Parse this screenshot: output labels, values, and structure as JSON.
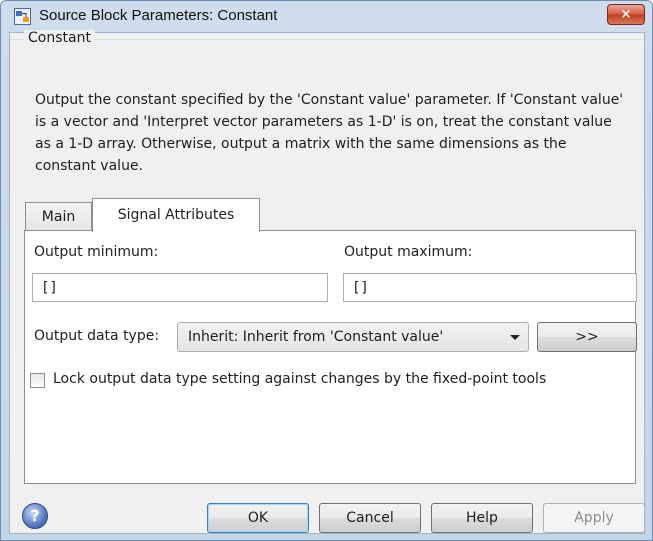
{
  "window": {
    "title": "Source Block Parameters: Constant",
    "close_glyph": "×"
  },
  "group": {
    "label": "Constant",
    "description": "Output the constant specified by the 'Constant value' parameter. If 'Constant value' is a vector and 'Interpret vector parameters as 1-D' is on, treat the constant value as a 1-D array. Otherwise, output a matrix with the same dimensions as the constant value."
  },
  "tabs": [
    {
      "label": "Main",
      "active": false
    },
    {
      "label": "Signal Attributes",
      "active": true
    }
  ],
  "signal_attributes": {
    "output_minimum_label": "Output minimum:",
    "output_minimum_value": "[]",
    "output_maximum_label": "Output maximum:",
    "output_maximum_value": "[]",
    "output_data_type_label": "Output data type:",
    "output_data_type_value": "Inherit: Inherit from 'Constant value'",
    "show_assistant_label": ">>",
    "lock_checkbox_label": "Lock output data type setting against changes by the fixed-point tools",
    "lock_checked": false
  },
  "buttons": {
    "ok": "OK",
    "cancel": "Cancel",
    "help": "Help",
    "apply": "Apply"
  },
  "colors": {
    "titlebar": "#cfdcec",
    "close_button": "#c03d22",
    "dialog_bg": "#f0f0f0"
  },
  "icons": {
    "app": "simulink-block-icon",
    "help": "help-question-icon",
    "close": "close-icon",
    "dropdown": "chevron-down-icon"
  }
}
